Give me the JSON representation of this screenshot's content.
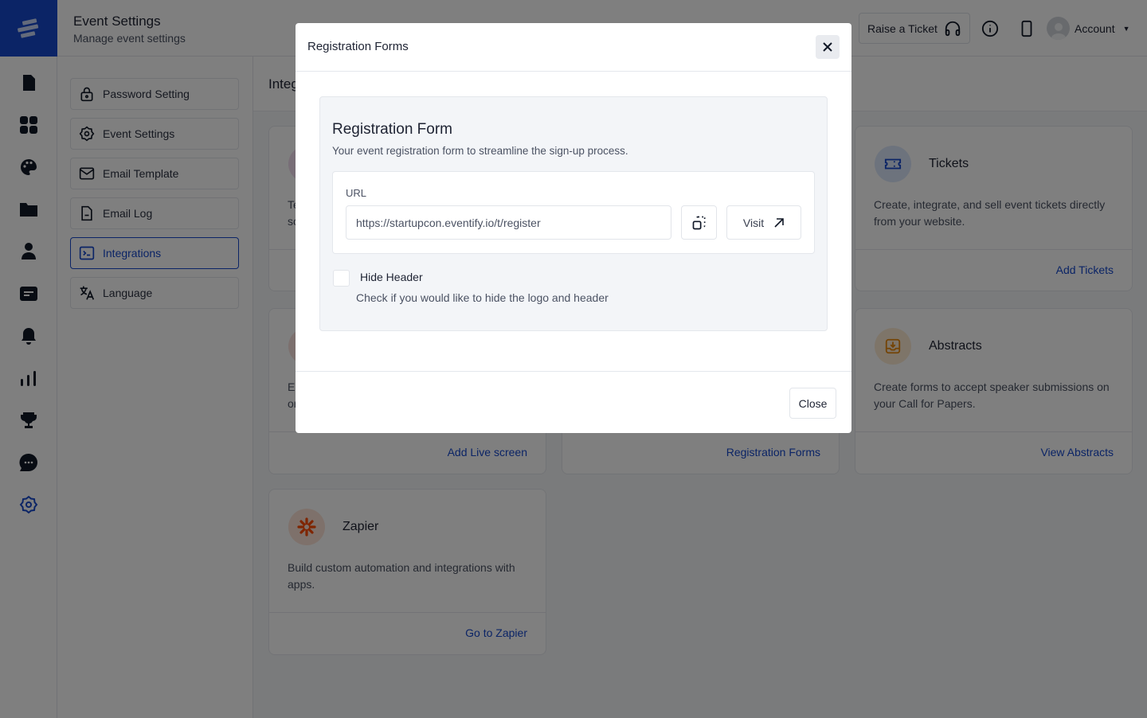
{
  "header": {
    "title": "Event Settings",
    "subtitle": "Manage event settings",
    "raise_ticket": "Raise a Ticket",
    "account": "Account"
  },
  "settings_nav": [
    {
      "label": "Password Setting",
      "icon": "lock-icon"
    },
    {
      "label": "Event Settings",
      "icon": "gear-icon"
    },
    {
      "label": "Email Template",
      "icon": "mail-icon"
    },
    {
      "label": "Email Log",
      "icon": "document-icon"
    },
    {
      "label": "Integrations",
      "icon": "terminal-icon",
      "active": true
    },
    {
      "label": "Language",
      "icon": "translate-icon"
    }
  ],
  "main": {
    "title_fragment": "Integ",
    "cards": {
      "col1_row1": {
        "desc_fragment_1": "Te",
        "desc_fragment_2": "sc"
      },
      "col1_row2": {
        "desc_fragment_1": "Er",
        "desc_fragment_2": "or",
        "link": "Add Live screen"
      },
      "col2_row2": {
        "link": "Registration Forms"
      },
      "tickets": {
        "title": "Tickets",
        "desc": "Create, integrate, and sell event tickets directly from your website.",
        "link": "Add Tickets"
      },
      "abstracts": {
        "title": "Abstracts",
        "desc": "Create forms to accept speaker submissions on your Call for Papers.",
        "link": "View Abstracts"
      },
      "zapier": {
        "title": "Zapier",
        "desc": "Build custom automation and integrations with apps.",
        "link": "Go to Zapier"
      }
    }
  },
  "modal": {
    "title": "Registration Forms",
    "panel_title": "Registration Form",
    "panel_subtitle": "Your event registration form to streamline the sign-up process.",
    "url_label": "URL",
    "url_value": "https://startupcon.eventify.io/t/register",
    "visit": "Visit",
    "hide_header_label": "Hide Header",
    "hide_header_checked": false,
    "hide_header_desc": "Check if you would like to hide the logo and header",
    "close": "Close"
  },
  "colors": {
    "accent": "#1648cc",
    "overlay": "rgba(0,0,0,0.5)"
  }
}
